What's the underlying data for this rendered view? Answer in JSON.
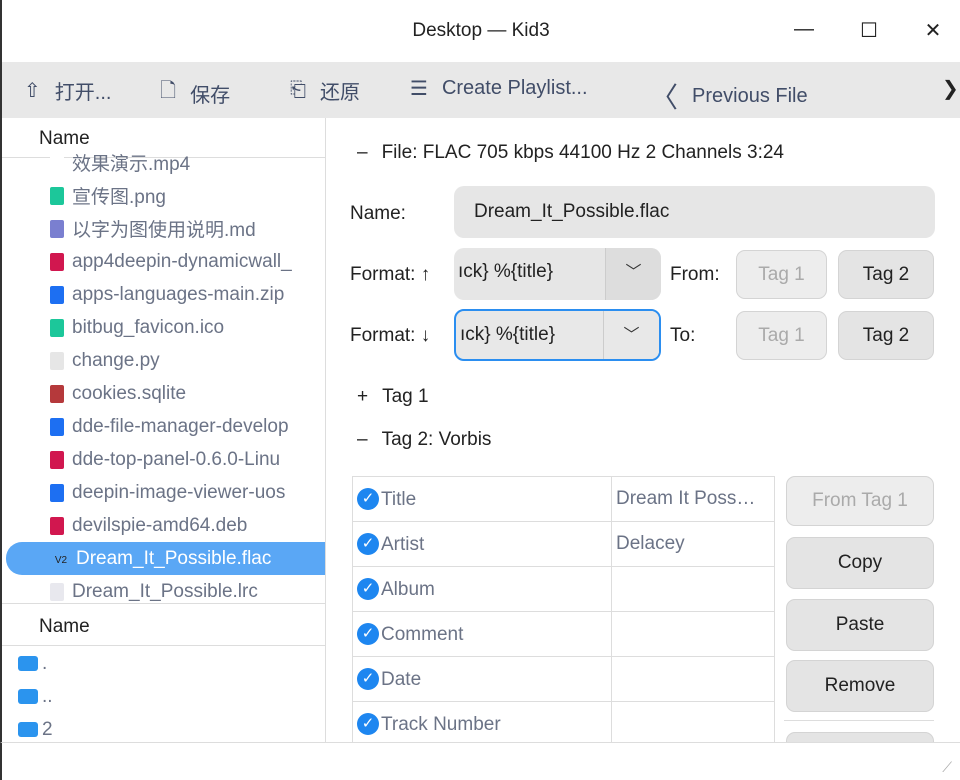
{
  "window": {
    "title": "Desktop — Kid3",
    "minimize": "—",
    "maximize": "☐",
    "close": "✕"
  },
  "toolbar": {
    "open": "打开...",
    "save": "保存",
    "revert": "还原",
    "create_playlist": "Create Playlist...",
    "previous_file": "Previous File",
    "more": "❯❯"
  },
  "files": {
    "header": "Name",
    "items": [
      {
        "name": "效果演示.mp4",
        "type": "none",
        "color": "#fff"
      },
      {
        "name": "宣传图.png",
        "type": "PNG",
        "color": "#1cc79a"
      },
      {
        "name": "以字为图使用说明.md",
        "type": "MD",
        "color": "#7a7fd0"
      },
      {
        "name": "app4deepin-dynamicwall_",
        "type": "deb",
        "color": "#d1174f"
      },
      {
        "name": "apps-languages-main.zip",
        "type": "ZIP",
        "color": "#1d6ff2"
      },
      {
        "name": "bitbug_favicon.ico",
        "type": "ICO",
        "color": "#1cc79a"
      },
      {
        "name": "change.py",
        "type": "py",
        "color": "#e6e6e6"
      },
      {
        "name": "cookies.sqlite",
        "type": "db",
        "color": "#b5393b"
      },
      {
        "name": "dde-file-manager-develop",
        "type": "ZIP",
        "color": "#1d6ff2"
      },
      {
        "name": "dde-top-panel-0.6.0-Linu",
        "type": "deb",
        "color": "#d1174f"
      },
      {
        "name": "deepin-image-viewer-uos",
        "type": "ZIP",
        "color": "#1d6ff2"
      },
      {
        "name": "devilspie-amd64.deb",
        "type": "deb",
        "color": "#d1174f"
      },
      {
        "name": "Dream_It_Possible.flac",
        "type": "V2",
        "color": "transparent",
        "selected": true
      },
      {
        "name": "Dream_It_Possible.lrc",
        "type": "txt",
        "color": "#e8e8ee"
      }
    ]
  },
  "dirs": {
    "header": "Name",
    "items": [
      ".",
      "..",
      "2"
    ]
  },
  "file_info": {
    "toggle": "–",
    "text": "File: FLAC 705 kbps 44100 Hz 2 Channels 3:24"
  },
  "name_label": "Name:",
  "name_value": "Dream_It_Possible.flac",
  "format_up": {
    "label": "Format: ↑",
    "value": "ıck} %{title}",
    "from": "From:",
    "tag1": "Tag 1",
    "tag2": "Tag 2"
  },
  "format_down": {
    "label": "Format: ↓",
    "value": "ıck} %{title}",
    "to": "To:",
    "tag1": "Tag 1",
    "tag2": "Tag 2"
  },
  "tag1": {
    "toggle": "+",
    "label": "Tag 1"
  },
  "tag2": {
    "toggle": "–",
    "label": "Tag 2: Vorbis"
  },
  "frames": [
    {
      "name": "Title",
      "value": "Dream It Poss…"
    },
    {
      "name": "Artist",
      "value": "Delacey"
    },
    {
      "name": "Album",
      "value": ""
    },
    {
      "name": "Comment",
      "value": ""
    },
    {
      "name": "Date",
      "value": ""
    },
    {
      "name": "Track Number",
      "value": ""
    }
  ],
  "actions": {
    "from_tag1": "From Tag 1",
    "copy": "Copy",
    "paste": "Paste",
    "remove": "Remove"
  }
}
